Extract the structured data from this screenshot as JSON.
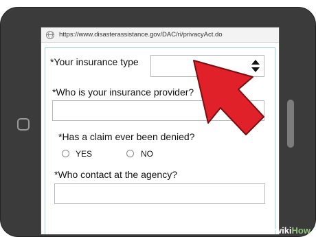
{
  "browser": {
    "url": "https://www.disasterassistance.gov/DAC/ri/privacyAct.do"
  },
  "form": {
    "insurance_type_label": "*Your insurance type",
    "insurance_type_value": "",
    "provider_label": "*Who is your insurance provider?",
    "provider_value": "",
    "claim_denied_label": "*Has a claim ever been denied?",
    "yes_label": "YES",
    "no_label": "NO",
    "contact_label": "*Who contact at the agency?",
    "contact_value": ""
  },
  "watermark": {
    "wiki": "wiki",
    "how": "How"
  },
  "colors": {
    "tablet_body": "#3b3b3b",
    "form_border": "#9fd3d6",
    "arrow": "#e0212a"
  }
}
